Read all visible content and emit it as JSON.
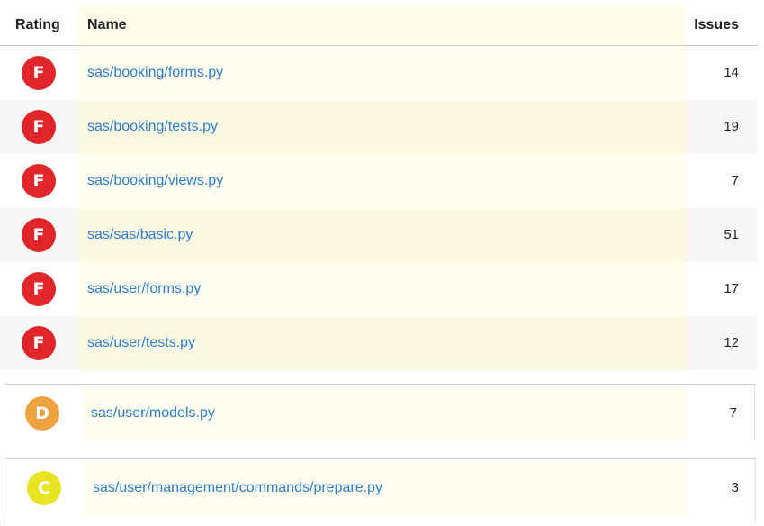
{
  "colors": {
    "F": "#e0262b",
    "D": "#eea23f",
    "C": "#e6e423",
    "link": "#2f7ecb"
  },
  "header": {
    "rating": "Rating",
    "name": "Name",
    "issues": "Issues"
  },
  "rows": [
    {
      "rating": "F",
      "name": "sas/booking/forms.py",
      "issues": "14"
    },
    {
      "rating": "F",
      "name": "sas/booking/tests.py",
      "issues": "19"
    },
    {
      "rating": "F",
      "name": "sas/booking/views.py",
      "issues": "7"
    },
    {
      "rating": "F",
      "name": "sas/sas/basic.py",
      "issues": "51"
    },
    {
      "rating": "F",
      "name": "sas/user/forms.py",
      "issues": "17"
    },
    {
      "rating": "F",
      "name": "sas/user/tests.py",
      "issues": "12"
    },
    {
      "rating": "D",
      "name": "sas/user/models.py",
      "issues": "7"
    },
    {
      "rating": "C",
      "name": "sas/user/management/commands/prepare.py",
      "issues": "3"
    }
  ]
}
